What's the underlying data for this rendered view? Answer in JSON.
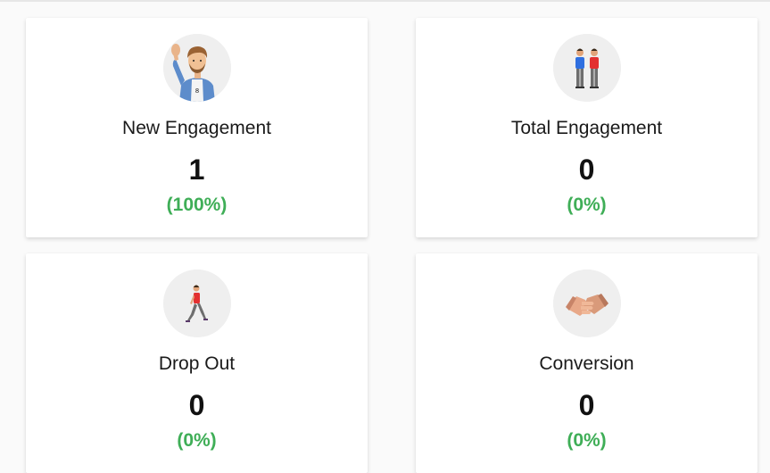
{
  "colors": {
    "accent_green": "#3fae57",
    "icon_circle": "#efefef",
    "card_bg": "#ffffff"
  },
  "cards": [
    {
      "icon": "waving-man-icon",
      "label": "New Engagement",
      "value": "1",
      "percent": "(100%)"
    },
    {
      "icon": "two-people-icon",
      "label": "Total Engagement",
      "value": "0",
      "percent": "(0%)"
    },
    {
      "icon": "walking-person-icon",
      "label": "Drop Out",
      "value": "0",
      "percent": "(0%)"
    },
    {
      "icon": "handshake-icon",
      "label": "Conversion",
      "value": "0",
      "percent": "(0%)"
    }
  ]
}
